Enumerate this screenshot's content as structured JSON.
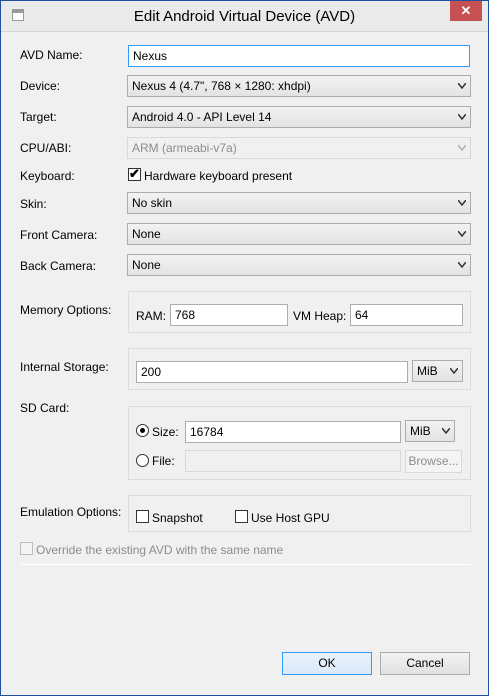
{
  "window": {
    "title": "Edit Android Virtual Device (AVD)",
    "close_label": "✕"
  },
  "form": {
    "avd_name_label": "AVD Name:",
    "avd_name_value": "Nexus",
    "device_label": "Device:",
    "device_value": "Nexus 4 (4.7\", 768 × 1280: xhdpi)",
    "target_label": "Target:",
    "target_value": "Android 4.0 - API Level 14",
    "cpu_label": "CPU/ABI:",
    "cpu_value": "ARM (armeabi-v7a)",
    "keyboard_label": "Keyboard:",
    "keyboard_checkbox_label": "Hardware keyboard present",
    "keyboard_checked": true,
    "skin_label": "Skin:",
    "skin_value": "No skin",
    "front_camera_label": "Front Camera:",
    "front_camera_value": "None",
    "back_camera_label": "Back Camera:",
    "back_camera_value": "None"
  },
  "memory": {
    "label": "Memory Options:",
    "ram_label": "RAM:",
    "ram_value": "768",
    "vm_heap_label": "VM Heap:",
    "vm_heap_value": "64"
  },
  "storage": {
    "label": "Internal Storage:",
    "value": "200",
    "unit": "MiB"
  },
  "sdcard": {
    "label": "SD Card:",
    "size_label": "Size:",
    "size_value": "16784",
    "size_unit": "MiB",
    "file_label": "File:",
    "file_value": "",
    "browse_label": "Browse...",
    "selected": "size"
  },
  "emulation": {
    "label": "Emulation Options:",
    "snapshot_label": "Snapshot",
    "host_gpu_label": "Use Host GPU"
  },
  "override_label": "Override the existing AVD with the same name",
  "buttons": {
    "ok": "OK",
    "cancel": "Cancel"
  },
  "colors": {
    "focus_border": "#3399ff",
    "close_bg": "#c75050",
    "frame_border": "#1f4e9e"
  }
}
